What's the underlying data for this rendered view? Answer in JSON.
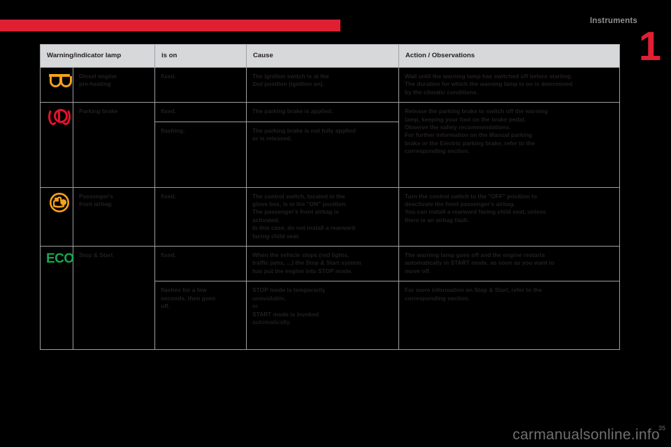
{
  "page": {
    "chapter_title": "Instruments",
    "chapter_number": "1",
    "page_number": "35",
    "watermark": "carmanualsonline.info",
    "accent_red": "#e01f33",
    "header_bg": "#d7d8da"
  },
  "table": {
    "headers": {
      "lamp": "Warning/indicator lamp",
      "is_on": "is on",
      "cause": "Cause",
      "action": "Action / Observations"
    },
    "rows": [
      {
        "icon": "diesel-preheat-icon",
        "icon_color": "#f5a11c",
        "name_line1": "Diesel engine",
        "name_line2": "pre-heating",
        "states": [
          {
            "is_on": "fixed.",
            "cause": [
              "The ignition switch is at the",
              "2nd position (ignition on)."
            ],
            "action": [
              "Wait until the warning lamp has switched off before starting.",
              "The duration for which the warning lamp is on is determined",
              "by the climatic conditions."
            ]
          }
        ]
      },
      {
        "icon": "parking-brake-icon",
        "icon_color": "#e8112d",
        "name_line1": "Parking brake",
        "name_line2": "",
        "states": [
          {
            "is_on": "fixed.",
            "cause": [
              "The parking brake is applied."
            ],
            "action": [
              "Release the parking brake to switch off the warning",
              "lamp, keeping your foot on the brake pedal.",
              "Observe the safety recommendations.",
              "For further information on the Manual parking",
              "brake or the Electric parking brake, refer to the",
              "corresponding section."
            ]
          },
          {
            "is_on": "flashing.",
            "cause": [
              "The parking brake is not fully applied",
              "or is released."
            ],
            "action": []
          }
        ]
      },
      {
        "icon": "passenger-airbag-icon",
        "icon_color": "#f5a11c",
        "name_line1": "Passenger's",
        "name_line2": "front airbag",
        "states": [
          {
            "is_on": "fixed.",
            "cause": [
              "The control switch, located in the",
              "glove box, is in the \"ON\" position.",
              "The passenger's front airbag is",
              "activated.",
              "In this case, do not install a rearward",
              "facing child seat."
            ],
            "action": [
              "Turn the control switch to the \"OFF\" position to",
              "deactivate the front passenger's airbag.",
              "You can install a rearward facing child seat, unless",
              "there is an airbag fault."
            ]
          }
        ]
      },
      {
        "icon": "eco-icon",
        "icon_color": "#16a94d",
        "name_line1": "Stop & Start",
        "name_line2": "",
        "states": [
          {
            "is_on": "fixed.",
            "cause": [
              "When the vehicle stops (red lights,",
              "traffic jams, ...) the Stop & Start system",
              "has put the engine into STOP mode."
            ],
            "action": [
              "The warning lamp goes off and the engine restarts",
              "automatically in START mode, as soon as you want to",
              "move off."
            ]
          },
          {
            "is_on_lines": [
              "flashes for a few",
              "seconds, then goes",
              "off."
            ],
            "cause": [
              "STOP mode is temporarily",
              "unavailable,",
              "or",
              "START mode is invoked",
              "automatically."
            ],
            "action": [
              "For more information on Stop & Start, refer to the",
              "corresponding section."
            ]
          }
        ]
      }
    ]
  }
}
